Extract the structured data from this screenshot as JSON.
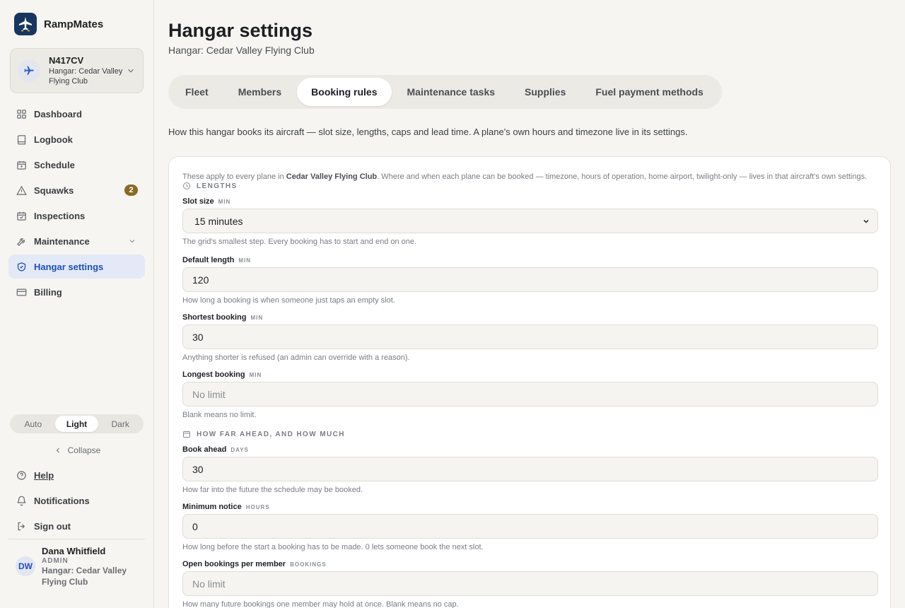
{
  "app": {
    "name": "RampMates"
  },
  "plane_switcher": {
    "tail": "N417CV",
    "hangar": "Hangar: Cedar Valley Flying Club"
  },
  "sidebar": {
    "items": [
      {
        "label": "Dashboard",
        "icon": "grid-icon"
      },
      {
        "label": "Logbook",
        "icon": "book-icon"
      },
      {
        "label": "Schedule",
        "icon": "calendar-icon"
      },
      {
        "label": "Squawks",
        "icon": "warning-icon",
        "badge": "2"
      },
      {
        "label": "Inspections",
        "icon": "calendar-check-icon"
      },
      {
        "label": "Maintenance",
        "icon": "wrench-icon"
      },
      {
        "label": "Hangar settings",
        "icon": "shield-icon",
        "active": true
      },
      {
        "label": "Billing",
        "icon": "card-icon"
      }
    ],
    "theme": {
      "auto": "Auto",
      "light": "Light",
      "dark": "Dark",
      "selected": "Light"
    },
    "collapse_label": "Collapse",
    "help_label": "Help",
    "notifications_label": "Notifications",
    "signout_label": "Sign out",
    "user": {
      "initials": "DW",
      "name": "Dana Whitfield",
      "role": "ADMIN",
      "hangar": "Hangar: Cedar Valley Flying Club"
    }
  },
  "header": {
    "title": "Hangar settings",
    "subtitle": "Hangar: Cedar Valley Flying Club"
  },
  "tabs": [
    {
      "label": "Fleet"
    },
    {
      "label": "Members"
    },
    {
      "label": "Booking rules",
      "active": true
    },
    {
      "label": "Maintenance tasks"
    },
    {
      "label": "Supplies"
    },
    {
      "label": "Fuel payment methods"
    }
  ],
  "intro": "How this hangar books its aircraft — slot size, lengths, caps and lead time. A plane's own hours and timezone live in its settings.",
  "note": {
    "pre": "These apply to every plane in ",
    "club": "Cedar Valley Flying Club",
    "post": ". Where and when each plane can be booked — timezone, hours of operation, home airport, twilight-only — lives in that aircraft's own settings."
  },
  "sections": {
    "lengths": "LENGTHS",
    "ahead": "HOW FAR AHEAD, AND HOW MUCH"
  },
  "fields": {
    "slot_size": {
      "label": "Slot size",
      "unit": "MIN",
      "value": "15 minutes",
      "hint": "The grid's smallest step. Every booking has to start and end on one."
    },
    "default_length": {
      "label": "Default length",
      "unit": "MIN",
      "value": "120",
      "hint": "How long a booking is when someone just taps an empty slot."
    },
    "shortest": {
      "label": "Shortest booking",
      "unit": "MIN",
      "value": "30",
      "hint": "Anything shorter is refused (an admin can override with a reason)."
    },
    "longest": {
      "label": "Longest booking",
      "unit": "MIN",
      "placeholder": "No limit",
      "hint": "Blank means no limit."
    },
    "book_ahead": {
      "label": "Book ahead",
      "unit": "DAYS",
      "value": "30",
      "hint": "How far into the future the schedule may be booked."
    },
    "min_notice": {
      "label": "Minimum notice",
      "unit": "HOURS",
      "value": "0",
      "hint": "How long before the start a booking has to be made. 0 lets someone book the next slot."
    },
    "open_bookings": {
      "label": "Open bookings per member",
      "unit": "BOOKINGS",
      "placeholder": "No limit",
      "hint": "How many future bookings one member may hold at once. Blank means no cap."
    }
  },
  "colors": {
    "accent": "#1f4fb8",
    "active_bg": "#e3e9f6",
    "badge": "#8a6a22",
    "brand": "#17375e"
  }
}
